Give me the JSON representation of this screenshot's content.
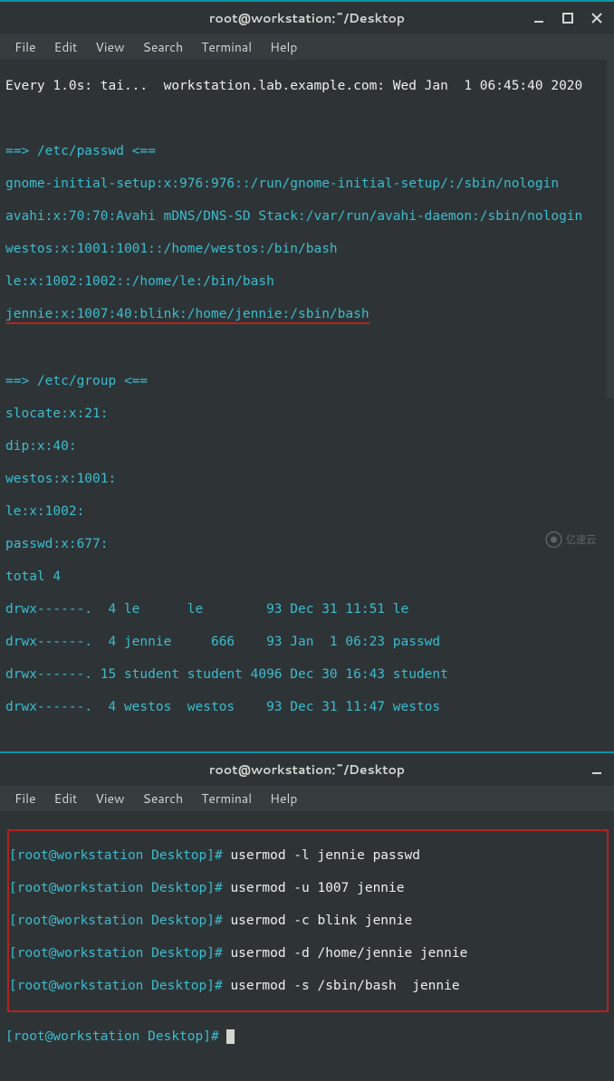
{
  "window1": {
    "title": "root@workstation:~/Desktop",
    "menubar": [
      "File",
      "Edit",
      "View",
      "Search",
      "Terminal",
      "Help"
    ]
  },
  "window2": {
    "title": "root@workstation:~/Desktop",
    "menubar": [
      "File",
      "Edit",
      "View",
      "Search",
      "Terminal",
      "Help"
    ]
  },
  "controls": {
    "minimize": "minimize",
    "maximize": "maximize",
    "close": "close"
  },
  "terminal1": {
    "header": "Every 1.0s: tai...  workstation.lab.example.com: Wed Jan  1 06:45:40 2020",
    "blank1": " ",
    "passwd_hdr": "==> /etc/passwd <==",
    "p1": "gnome-initial-setup:x:976:976::/run/gnome-initial-setup/:/sbin/nologin",
    "p2": "avahi:x:70:70:Avahi mDNS/DNS-SD Stack:/var/run/avahi-daemon:/sbin/nologin",
    "p3": "westos:x:1001:1001::/home/westos:/bin/bash",
    "p4": "le:x:1002:1002::/home/le:/bin/bash",
    "p5": "jennie:x:1007:40:blink:/home/jennie:/sbin/bash",
    "blank2": " ",
    "group_hdr": "==> /etc/group <==",
    "g1": "slocate:x:21:",
    "g2": "dip:x:40:",
    "g3": "westos:x:1001:",
    "g4": "le:x:1002:",
    "g5": "passwd:x:677:",
    "total": "total 4",
    "l1": "drwx------.  4 le      le        93 Dec 31 11:51 le",
    "l2": "drwx------.  4 jennie     666    93 Jan  1 06:23 passwd",
    "l3": "drwx------. 15 student student 4096 Dec 30 16:43 student",
    "l4": "drwx------.  4 westos  westos    93 Dec 31 11:47 westos"
  },
  "terminal2": {
    "prompt": "[root@workstation Desktop]# ",
    "c1": "usermod -l jennie passwd",
    "c2": "usermod -u 1007 jennie",
    "c3": "usermod -c blink jennie",
    "c4": "usermod -d /home/jennie jennie",
    "c5": "usermod -s /sbin/bash  jennie"
  },
  "watermark": "亿速云"
}
